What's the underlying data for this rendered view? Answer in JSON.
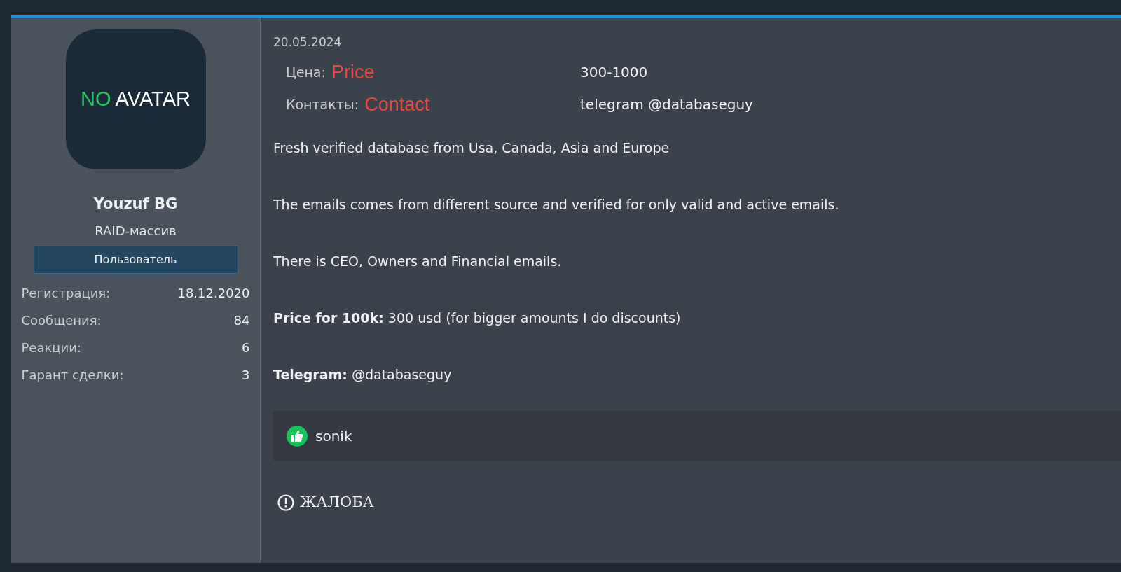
{
  "user": {
    "avatar": {
      "parts": [
        {
          "text": "NO",
          "color": "#22c55e"
        },
        {
          "text": "AVATAR",
          "color": "#ffffff"
        }
      ]
    },
    "name": "Youzuf BG",
    "title": "RAID-массив",
    "role": "Пользователь",
    "stats": [
      {
        "label": "Регистрация:",
        "value": "18.12.2020"
      },
      {
        "label": "Сообщения:",
        "value": "84"
      },
      {
        "label": "Реакции:",
        "value": "6"
      },
      {
        "label": "Гарант сделки:",
        "value": "3"
      }
    ]
  },
  "post": {
    "date": "20.05.2024",
    "fields": [
      {
        "label": "Цена:",
        "hint": "Price",
        "value": "300-1000"
      },
      {
        "label": "Контакты:",
        "hint": "Contact",
        "value": "telegram @databaseguy"
      }
    ],
    "paragraphs": [
      "Fresh verified database from Usa, Canada, Asia and Europe",
      "The emails comes from different source and verified for only valid and active emails.",
      "There is CEO, Owners and Financial emails.",
      "**Price for 100k:** 300 usd (for bigger amounts I do discounts)",
      "**Telegram:** @databaseguy"
    ],
    "reactions": {
      "users": "sonik"
    },
    "report": "ЖАЛОБА"
  }
}
